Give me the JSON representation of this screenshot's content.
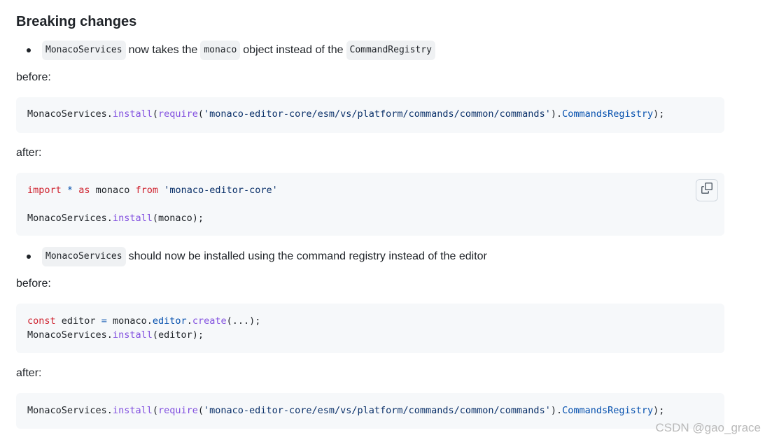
{
  "heading": "Breaking changes",
  "bullet1": {
    "code1": "MonacoServices",
    "text1": "now takes the",
    "code2": "monaco",
    "text2": "object instead of the",
    "code3": "CommandRegistry"
  },
  "before1": "before:",
  "code_block1": {
    "line1": {
      "obj": "MonacoServices",
      "dot": ".",
      "fn": "install",
      "paren_open": "(",
      "req": "require",
      "paren2": "(",
      "str": "'monaco-editor-core/esm/vs/platform/commands/common/commands'",
      "paren3": ").",
      "prop": "CommandsRegistry",
      "end": ");"
    }
  },
  "after1": "after:",
  "code_block2": {
    "line1": {
      "kw_import": "import",
      "star": "*",
      "kw_as": "as",
      "name": "monaco",
      "kw_from": "from",
      "str": "'monaco-editor-core'"
    },
    "line2": {
      "obj": "MonacoServices",
      "dot": ".",
      "fn": "install",
      "rest": "(monaco);"
    },
    "copy_icon": "copy-icon"
  },
  "bullet2": {
    "code1": "MonacoServices",
    "text1": "should now be installed using the command registry instead of the editor"
  },
  "before2": "before:",
  "code_block3": {
    "line1": {
      "kw_const": "const",
      "name": "editor",
      "eq": "=",
      "obj": "monaco",
      "dot1": ".",
      "prop": "editor",
      "dot2": ".",
      "fn": "create",
      "rest": "(...);"
    },
    "line2": {
      "obj": "MonacoServices",
      "dot": ".",
      "fn": "install",
      "rest": "(editor);"
    }
  },
  "after2": "after:",
  "code_block4": {
    "line1": {
      "obj": "MonacoServices",
      "dot": ".",
      "fn": "install",
      "paren_open": "(",
      "req": "require",
      "paren2": "(",
      "str": "'monaco-editor-core/esm/vs/platform/commands/common/commands'",
      "paren3": ").",
      "prop": "CommandsRegistry",
      "end": ");"
    }
  },
  "watermark": "CSDN @gao_grace"
}
